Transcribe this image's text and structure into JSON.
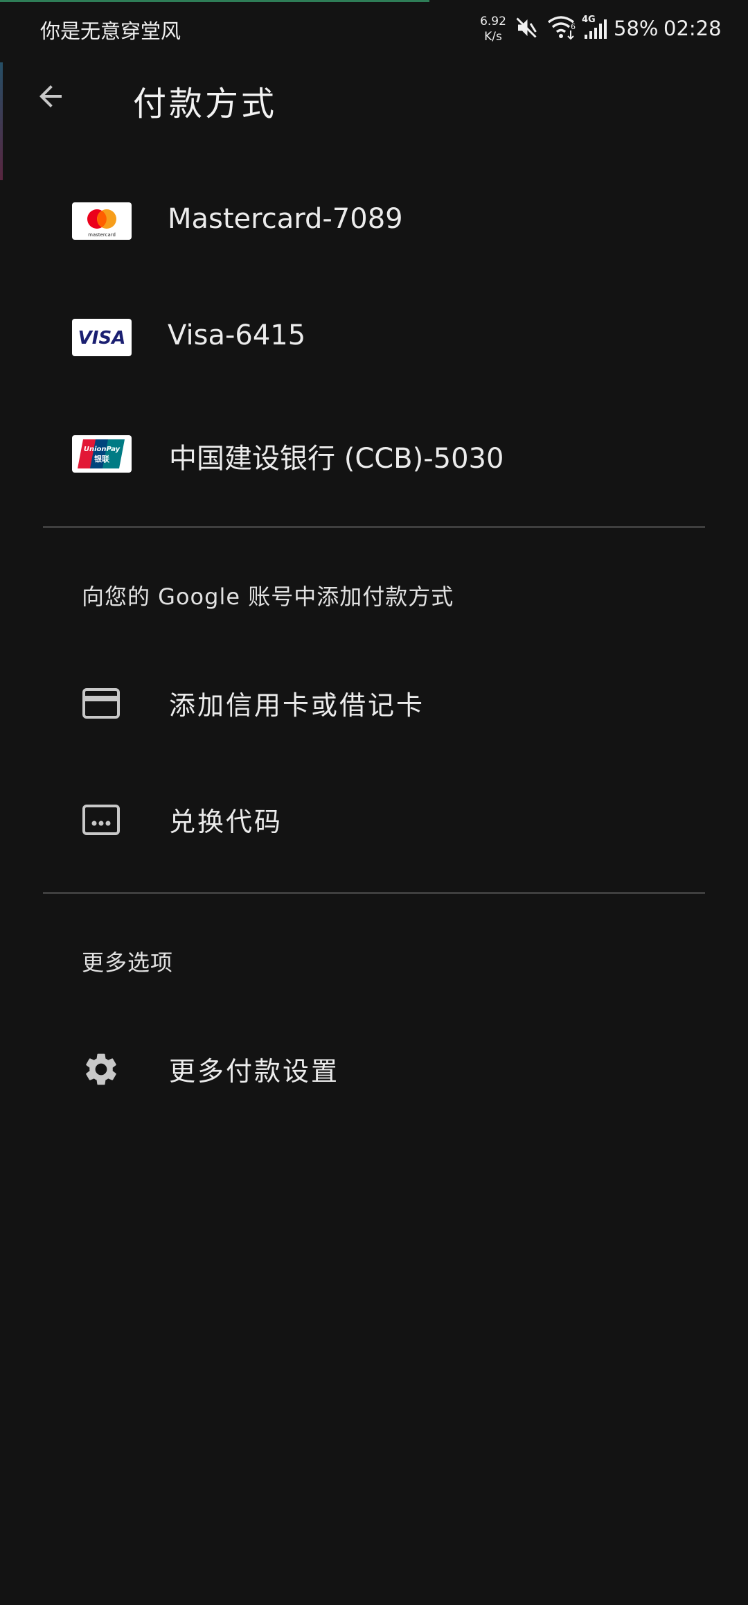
{
  "status_bar": {
    "carrier_text": "你是无意穿堂风",
    "net_speed_value": "6.92",
    "net_speed_unit": "K/s",
    "network_type": "4G",
    "battery": "58%",
    "time": "02:28"
  },
  "header": {
    "title": "付款方式"
  },
  "payment_methods": [
    {
      "label": "Mastercard-7089",
      "logo_text": "mastercard",
      "icon": "mastercard-logo"
    },
    {
      "label": "Visa-6415",
      "logo_text": "VISA",
      "icon": "visa-logo"
    },
    {
      "label": "中国建设银行 (CCB)-5030",
      "logo_text": "UnionPay",
      "logo_subtext": "银联",
      "icon": "unionpay-logo"
    }
  ],
  "add_section": {
    "heading": "向您的 Google 账号中添加付款方式",
    "actions": [
      {
        "label": "添加信用卡或借记卡",
        "icon": "credit-card-icon"
      },
      {
        "label": "兑换代码",
        "icon": "redeem-code-icon"
      }
    ]
  },
  "more_section": {
    "heading": "更多选项",
    "actions": [
      {
        "label": "更多付款设置",
        "icon": "gear-icon"
      }
    ]
  },
  "colors": {
    "background": "#131313",
    "text": "#ececec",
    "divider": "#3f3f3f",
    "icon": "#c8c8c8"
  }
}
